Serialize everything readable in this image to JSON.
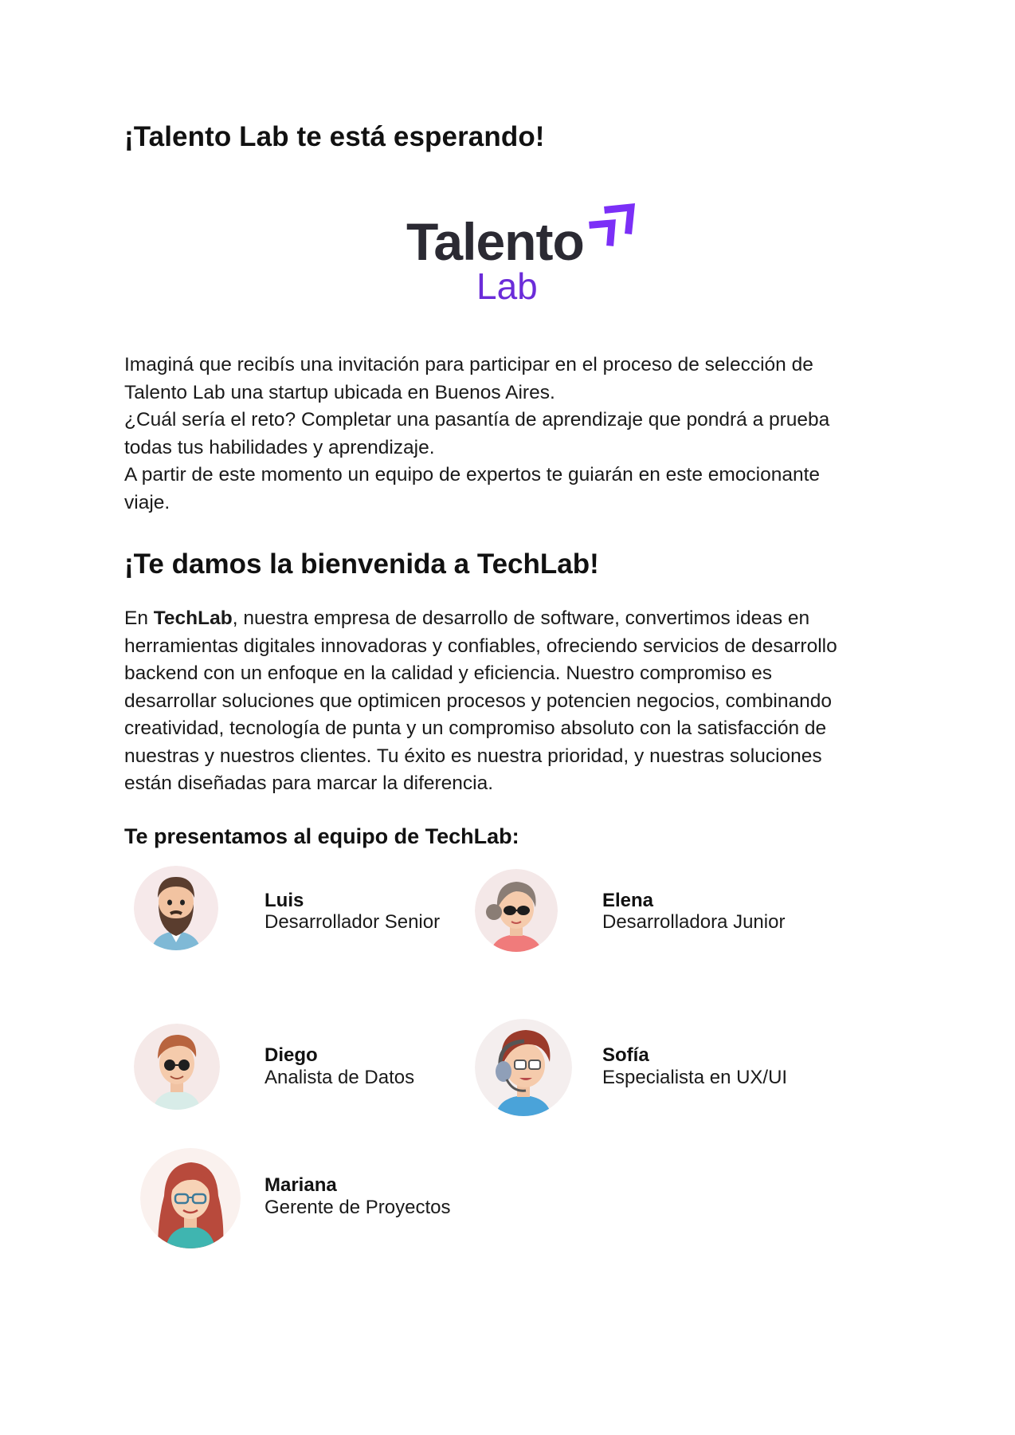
{
  "title": "¡Talento Lab te está esperando!",
  "logo": {
    "word_main": "Talento",
    "word_sub": "Lab",
    "colors": {
      "main": "#2b2a33",
      "accent": "#6b2cd9",
      "arrows": "#7b2ff7"
    },
    "icon": "double-arrow-up-right-icon"
  },
  "intro_lines": [
    "Imaginá que recibís una invitación para participar en el proceso de selección de",
    "Talento Lab una startup ubicada en Buenos Aires.",
    "¿Cuál sería el reto? Completar una pasantía de aprendizaje que pondrá a prueba",
    "todas tus habilidades y aprendizaje.",
    "A partir de este momento un equipo de expertos te guiarán en este emocionante",
    "viaje."
  ],
  "welcome_heading": "¡Te damos la bienvenida a TechLab!",
  "about": {
    "prefix": "En ",
    "company": "TechLab",
    "line1_rest": ", nuestra empresa de desarrollo de software, convertimos ideas en",
    "lines": [
      "herramientas digitales innovadoras y confiables, ofreciendo servicios de desarrollo",
      "backend con un enfoque en la calidad y eficiencia. Nuestro compromiso es",
      "desarrollar soluciones que optimicen procesos y potencien negocios, combinando",
      "creatividad, tecnología de punta y un compromiso absoluto con la satisfacción de",
      "nuestras y nuestros clientes. Tu éxito es nuestra prioridad, y nuestras soluciones",
      "están diseñadas para marcar la diferencia."
    ]
  },
  "team_heading": "Te presentamos al equipo de TechLab:",
  "team": [
    {
      "name": "Luis",
      "role": "Desarrollador Senior",
      "icon": "bearded-man-avatar-icon"
    },
    {
      "name": "Elena",
      "role": "Desarrolladora Junior",
      "icon": "woman-sunglasses-avatar-icon"
    },
    {
      "name": "Diego",
      "role": "Analista de Datos",
      "icon": "man-round-glasses-avatar-icon"
    },
    {
      "name": "Sofía",
      "role": "Especialista en UX/UI",
      "icon": "woman-headset-avatar-icon"
    },
    {
      "name": "Mariana",
      "role": "Gerente de Proyectos",
      "icon": "woman-glasses-avatar-icon"
    }
  ]
}
